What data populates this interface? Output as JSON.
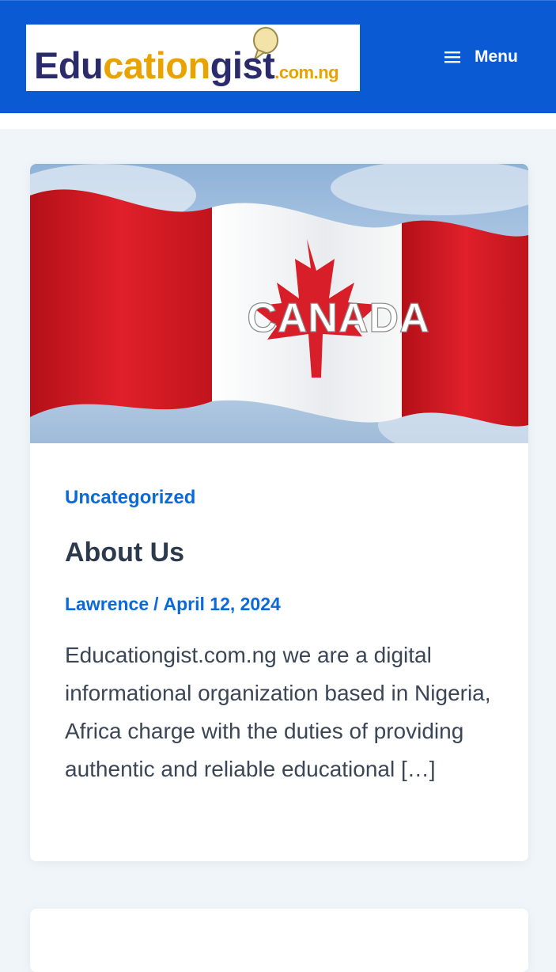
{
  "header": {
    "logo_alt": "Educationgist.com.ng",
    "logo_parts": {
      "edu": "Edu",
      "cation": "cation",
      "gist": "gist",
      "domain": ".com.ng"
    },
    "menu_label": "Menu",
    "colors": {
      "header_bg": "#0a5bd3",
      "link": "#0a6ad9",
      "title": "#2c3a4d"
    }
  },
  "post": {
    "image_text": "CANADA",
    "category": "Uncategorized",
    "title": "About Us",
    "author": "Lawrence",
    "separator": "/",
    "date": "April 12, 2024",
    "excerpt": "Educationgist.com.ng we are a digital informational organization based in Nigeria, Africa charge with the duties of providing authentic and reliable educational […]"
  }
}
